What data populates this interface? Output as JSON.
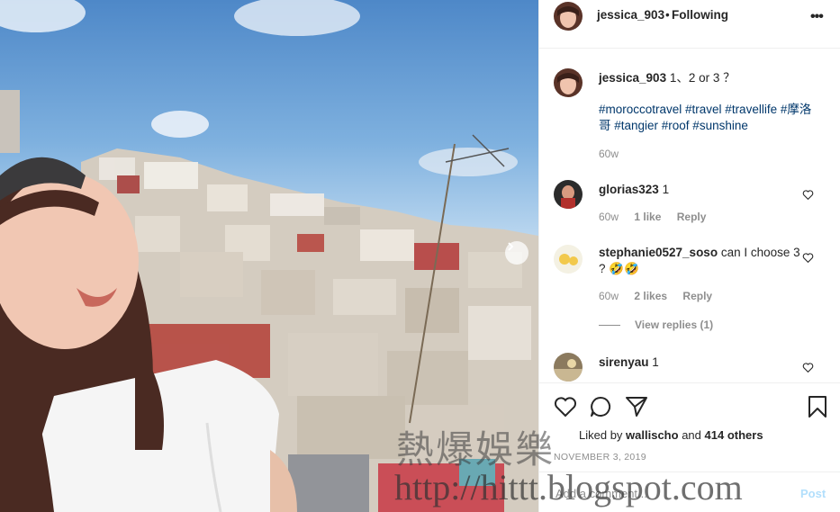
{
  "header": {
    "username": "jessica_903",
    "separator": "•",
    "follow_status": "Following",
    "more_icon": "more-dots-icon"
  },
  "caption": {
    "username": "jessica_903",
    "text": "1、2 or 3 ？",
    "hashtags": "#moroccotravel #travel #travellife #摩洛哥 #tangier #roof #sunshine",
    "age": "60w"
  },
  "comments": [
    {
      "username": "glorias323",
      "text": "1",
      "age": "60w",
      "likes": "1 like",
      "reply": "Reply"
    },
    {
      "username": "stephanie0527_soso",
      "text": "can I choose 3 ? 🤣🤣",
      "age": "60w",
      "likes": "2 likes",
      "reply": "Reply",
      "view_replies": "View replies (1)"
    },
    {
      "username": "sirenyau",
      "text": "1"
    }
  ],
  "actions": {
    "liked_prefix": "Liked by",
    "liked_user": "wallischo",
    "liked_and": "and",
    "liked_others": "414 others",
    "date": "NOVEMBER 3, 2019",
    "comment_placeholder": "Add a comment...",
    "post_label": "Post"
  },
  "watermark": {
    "line1": "熱爆娛樂",
    "line2": "http://hittt.blogspot.com"
  },
  "colors": {
    "hashtag": "#00376b",
    "muted": "#8e8e8e",
    "post_disabled": "#b2dffc"
  }
}
